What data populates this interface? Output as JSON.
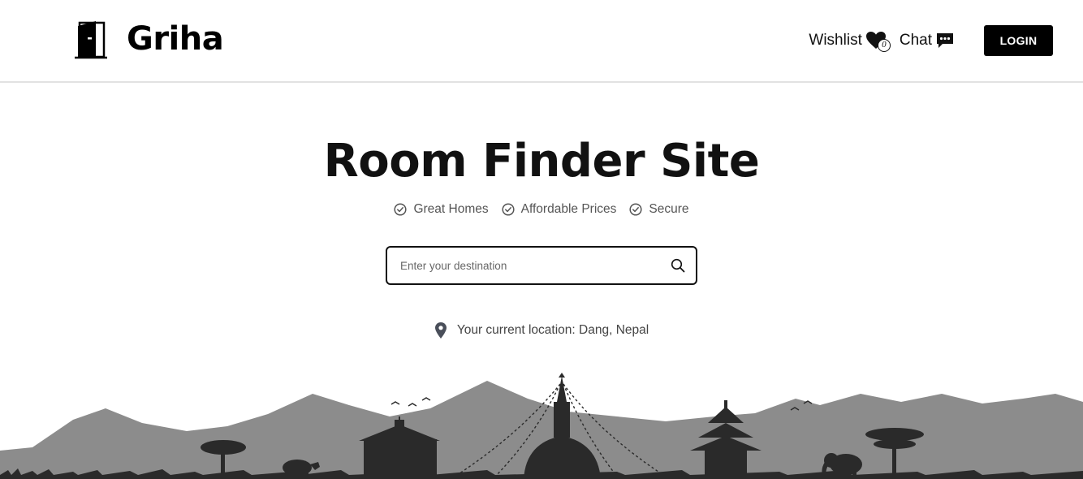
{
  "header": {
    "brand_name": "Griha",
    "logo_icon": "door-icon",
    "nav": {
      "wishlist_label": "Wishlist",
      "wishlist_count": "0",
      "wishlist_icon": "heart-icon",
      "chat_label": "Chat",
      "chat_icon": "chat-bubble-icon",
      "login_label": "LOGIN"
    }
  },
  "hero": {
    "title": "Room Finder Site",
    "features": [
      {
        "label": "Great Homes",
        "icon": "check-circle-icon"
      },
      {
        "label": "Affordable Prices",
        "icon": "check-circle-icon"
      },
      {
        "label": "Secure",
        "icon": "check-circle-icon"
      }
    ],
    "search": {
      "placeholder": "Enter your destination",
      "value": "",
      "icon": "search-icon"
    },
    "location": {
      "text": "Your current location: Dang, Nepal",
      "icon": "map-pin-icon"
    }
  },
  "colors": {
    "primary": "#000000",
    "text_muted": "#555555",
    "divider": "#e2e2e2",
    "mountain": "#8c8c8c",
    "silhouette": "#2a2a2a"
  }
}
